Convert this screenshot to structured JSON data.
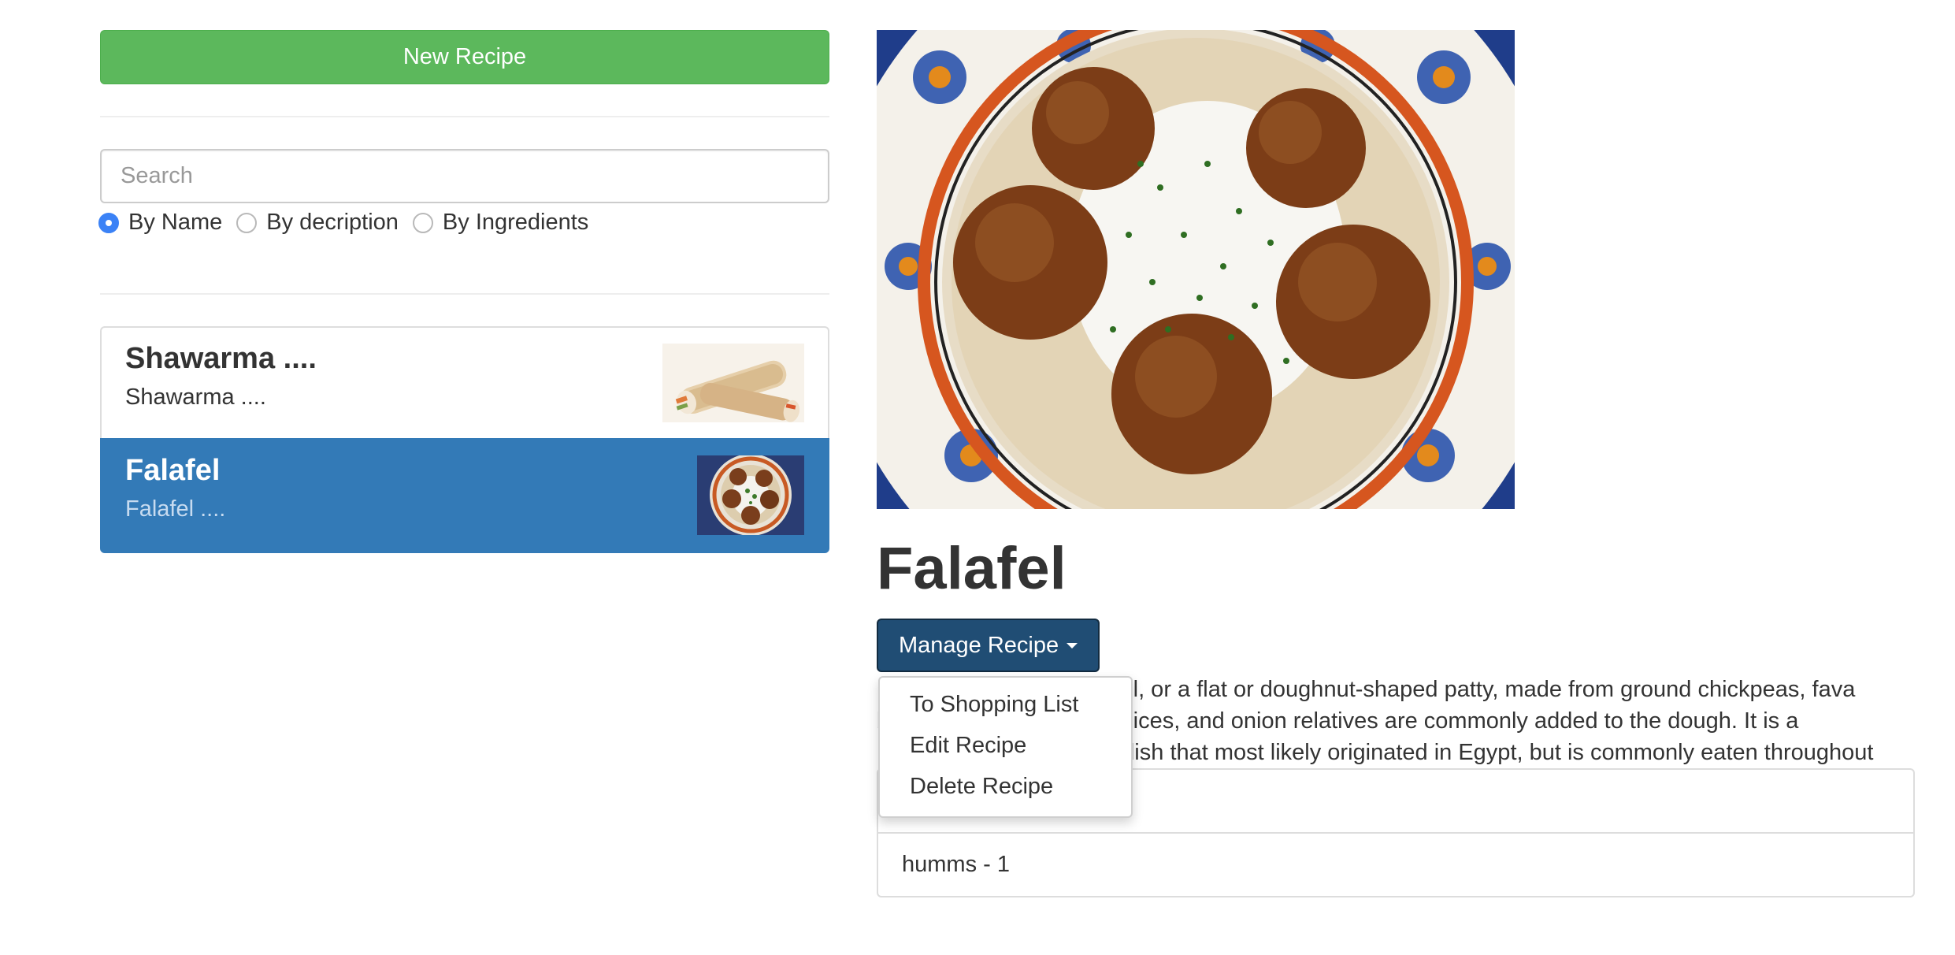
{
  "left": {
    "new_button_label": "New Recipe",
    "search_placeholder": "Search",
    "filters": [
      {
        "label": "By Name",
        "checked": true
      },
      {
        "label": "By decription",
        "checked": false
      },
      {
        "label": "By Ingredients",
        "checked": false
      }
    ],
    "recipes": [
      {
        "title": "Shawarma ....",
        "description": "Shawarma ....",
        "active": false,
        "thumb": "shawarma-wrap-photo"
      },
      {
        "title": "Falafel",
        "description": "Falafel ....",
        "active": true,
        "thumb": "falafel-plate-photo"
      }
    ]
  },
  "detail": {
    "image": "falafel-plate-photo",
    "title": "Falafel",
    "manage_label": "Manage Recipe",
    "description": "Falafel is a deep-fried ball, or a flat or doughnut-shaped patty, made from ground chickpeas, fava beans, or both. Herbs, spices, and onion relatives are commonly added to the dough. It is a Levantine and Egyptian dish that most likely originated in Egypt, but is commonly eaten throughout Western Asia",
    "ingredients": [
      {
        "text": ""
      },
      {
        "text": "humms - 1"
      }
    ],
    "dropdown_items": [
      "To Shopping List",
      "Edit Recipe",
      "Delete Recipe"
    ]
  },
  "colors": {
    "success": "#5cb85c",
    "primary": "#337ab7",
    "manage_active": "#204d74",
    "radio_accent": "#3b82f6"
  }
}
